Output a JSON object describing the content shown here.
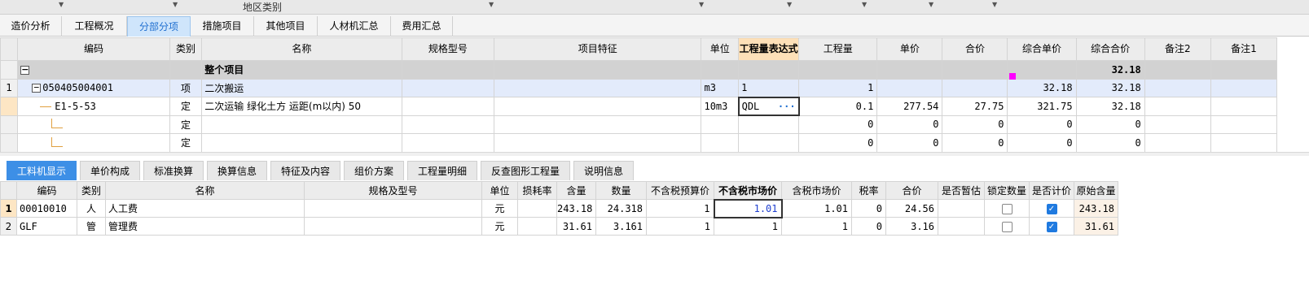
{
  "top": {
    "region_label": "地区类别"
  },
  "main_tabs": [
    "造价分析",
    "工程概况",
    "分部分项",
    "措施项目",
    "其他项目",
    "人材机汇总",
    "费用汇总"
  ],
  "upper": {
    "headers": {
      "code": "编码",
      "type": "类别",
      "name": "名称",
      "spec": "规格型号",
      "feature": "项目特征",
      "unit": "单位",
      "expr": "工程量表达式",
      "qty": "工程量",
      "price": "单价",
      "total": "合价",
      "uprice": "综合单价",
      "utotal": "综合合价",
      "note2": "备注2",
      "note1": "备注1"
    },
    "whole": {
      "toggle": "−",
      "name": "整个项目",
      "utotal": "32.18"
    },
    "item": {
      "rownum": "1",
      "toggle": "−",
      "code": "050405004001",
      "type": "项",
      "name": "二次搬运",
      "unit": "m3",
      "expr": "1",
      "qty": "1",
      "uprice": "32.18",
      "utotal": "32.18"
    },
    "quota": {
      "code": "E1-5-53",
      "type": "定",
      "name": "二次运输 绿化土方 运距(m以内) 50",
      "unit": "10m3",
      "expr": "QDL",
      "expr_btn": "···",
      "qty": "0.1",
      "price": "277.54",
      "total": "27.75",
      "uprice": "321.75",
      "utotal": "32.18"
    },
    "blank_rows": [
      {
        "type": "定",
        "qty": "0",
        "price": "0",
        "total": "0",
        "uprice": "0",
        "utotal": "0"
      },
      {
        "type": "定",
        "qty": "0",
        "price": "0",
        "total": "0",
        "uprice": "0",
        "utotal": "0"
      }
    ]
  },
  "bottom_tabs": [
    "工料机显示",
    "单价构成",
    "标准换算",
    "换算信息",
    "特征及内容",
    "组价方案",
    "工程量明细",
    "反查图形工程量",
    "说明信息"
  ],
  "lower": {
    "headers": {
      "code": "编码",
      "type": "类别",
      "name": "名称",
      "spec": "规格及型号",
      "unit": "单位",
      "loss": "损耗率",
      "content": "含量",
      "qty": "数量",
      "pre_price": "不含税预算价",
      "mkt_price": "不含税市场价",
      "tax_mkt": "含税市场价",
      "tax_rate": "税率",
      "total": "合价",
      "temp": "是否暂估",
      "lock": "锁定数量",
      "price_flag": "是否计价",
      "orig": "原始含量"
    },
    "rows": [
      {
        "rownum": "1",
        "code": "00010010",
        "type": "人",
        "name": "人工费",
        "unit": "元",
        "content": "243.18",
        "qty": "24.318",
        "pre_price": "1",
        "mkt_price": "1.01",
        "tax_mkt": "1.01",
        "tax_rate": "0",
        "total": "24.56",
        "lock": false,
        "price_flag": true,
        "orig": "243.18"
      },
      {
        "rownum": "2",
        "code": "GLF",
        "type": "管",
        "name": "管理费",
        "unit": "元",
        "content": "31.61",
        "qty": "3.161",
        "pre_price": "1",
        "mkt_price": "1",
        "tax_mkt": "1",
        "tax_rate": "0",
        "total": "3.16",
        "lock": false,
        "price_flag": true,
        "orig": "31.61"
      }
    ]
  },
  "colors": {
    "active_tab": "#3d8fe6",
    "item_row": "#e3ebfb",
    "whole_row": "#d2d2d2",
    "header_hl": "#fde0b8"
  }
}
